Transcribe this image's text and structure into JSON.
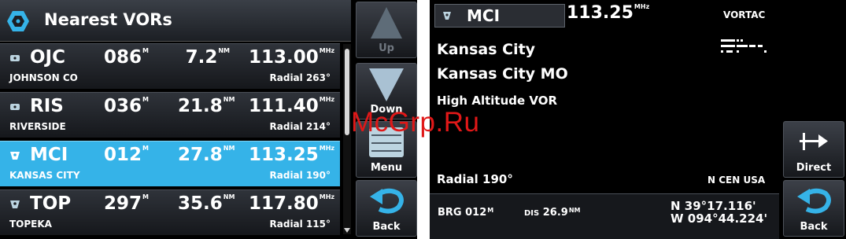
{
  "nearest": {
    "title": "Nearest VORs",
    "rows": [
      {
        "ident": "OJC",
        "name": "JOHNSON CO",
        "brg": "086",
        "brg_unit": "M",
        "dist": "7.2",
        "dist_unit": "NM",
        "freq": "113.00",
        "freq_unit": "MHz",
        "radial": "Radial 263°",
        "selected": false
      },
      {
        "ident": "RIS",
        "name": "RIVERSIDE",
        "brg": "036",
        "brg_unit": "M",
        "dist": "21.8",
        "dist_unit": "NM",
        "freq": "111.40",
        "freq_unit": "MHz",
        "radial": "Radial 214°",
        "selected": false
      },
      {
        "ident": "MCI",
        "name": "KANSAS CITY",
        "brg": "012",
        "brg_unit": "M",
        "dist": "27.8",
        "dist_unit": "NM",
        "freq": "113.25",
        "freq_unit": "MHz",
        "radial": "Radial 190°",
        "selected": true
      },
      {
        "ident": "TOP",
        "name": "TOPEKA",
        "brg": "297",
        "brg_unit": "M",
        "dist": "35.6",
        "dist_unit": "NM",
        "freq": "117.80",
        "freq_unit": "MHz",
        "radial": "Radial 115°",
        "selected": false
      }
    ],
    "softkeys": {
      "up": "Up",
      "down": "Down",
      "menu": "Menu",
      "back": "Back"
    }
  },
  "info": {
    "ident": "MCI",
    "freq": "113.25",
    "freq_unit": "MHz",
    "type": "VORTAC",
    "name": "Kansas City",
    "city": "Kansas City MO",
    "class": "High Altitude VOR",
    "radial": "Radial 190°",
    "region": "N CEN USA",
    "brg_label": "BRG",
    "brg": "012",
    "brg_unit": "M",
    "dis_label": "DIS",
    "dis": "26.9",
    "dis_unit": "NM",
    "lat": "N  39°17.116'",
    "lon": "W 094°44.224'",
    "softkeys": {
      "direct": "Direct",
      "back": "Back"
    }
  },
  "watermark": "McGrp.Ru",
  "colors": {
    "selected_row": "#35b3e8",
    "accent": "#35b3e8",
    "watermark": "#e01818"
  }
}
